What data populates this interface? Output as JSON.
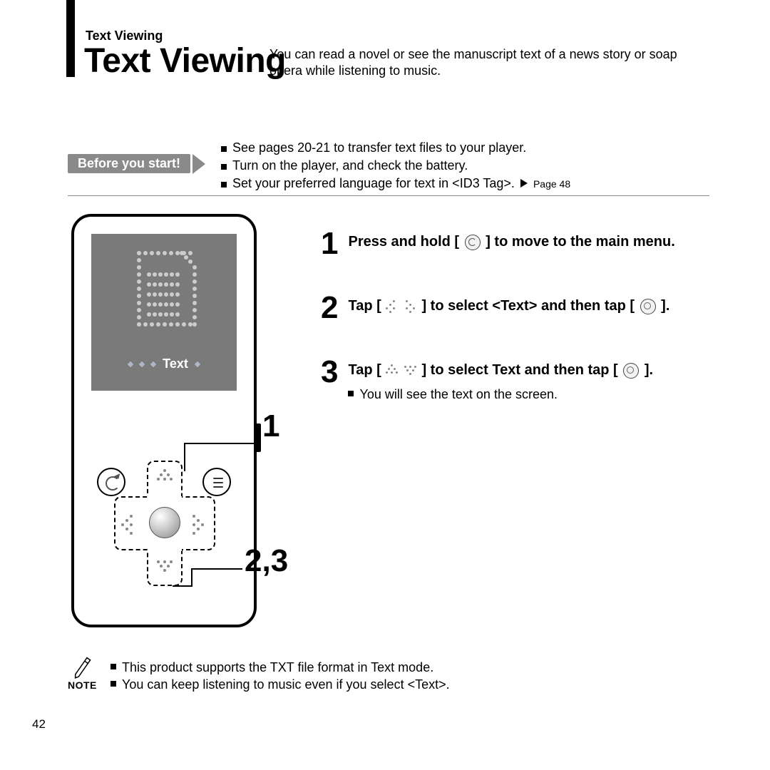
{
  "breadcrumb": "Text Viewing",
  "title": "Text Viewing",
  "intro": "You can read a novel or see the manuscript text of a news story or soap opera while listening to music.",
  "before_badge": "Before you start!",
  "prereqs": [
    "See pages 20-21 to transfer text files to your player.",
    "Turn on the player, and check the battery.",
    "Set your preferred language for text in <ID3 Tag>."
  ],
  "prereq_page_ref": "Page 48",
  "device_screen_label": "Text",
  "callout_1": "1",
  "callout_23": "2,3",
  "steps": {
    "s1_num": "1",
    "s1_text_a": "Press and hold [",
    "s1_text_b": "] to move to the main menu.",
    "s2_num": "2",
    "s2_text_a": "Tap [",
    "s2_text_b": "] to select <Text> and then tap [",
    "s2_text_c": "].",
    "s3_num": "3",
    "s3_text_a": "Tap [",
    "s3_text_b": "] to select Text and then tap [",
    "s3_text_c": "].",
    "s3_sub": "You will see the text on the screen."
  },
  "note_label": "NOTE",
  "notes": [
    "This product supports the TXT file format in Text mode.",
    "You can keep listening to music even if you select <Text>."
  ],
  "page_number": "42"
}
